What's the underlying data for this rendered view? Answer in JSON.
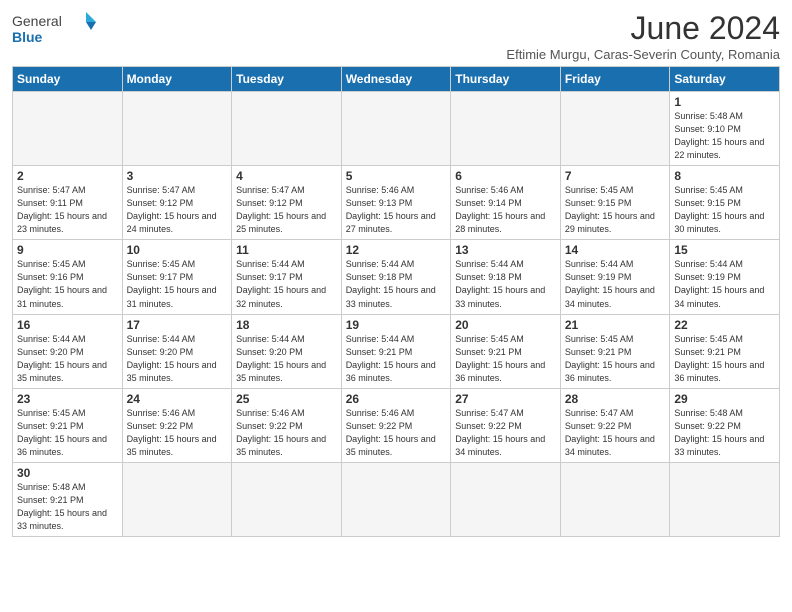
{
  "header": {
    "logo_general": "General",
    "logo_blue": "Blue",
    "month_title": "June 2024",
    "subtitle": "Eftimie Murgu, Caras-Severin County, Romania"
  },
  "weekdays": [
    "Sunday",
    "Monday",
    "Tuesday",
    "Wednesday",
    "Thursday",
    "Friday",
    "Saturday"
  ],
  "weeks": [
    [
      {
        "day": "",
        "info": ""
      },
      {
        "day": "",
        "info": ""
      },
      {
        "day": "",
        "info": ""
      },
      {
        "day": "",
        "info": ""
      },
      {
        "day": "",
        "info": ""
      },
      {
        "day": "",
        "info": ""
      },
      {
        "day": "1",
        "info": "Sunrise: 5:48 AM\nSunset: 9:10 PM\nDaylight: 15 hours\nand 22 minutes."
      }
    ],
    [
      {
        "day": "2",
        "info": "Sunrise: 5:47 AM\nSunset: 9:11 PM\nDaylight: 15 hours\nand 23 minutes."
      },
      {
        "day": "3",
        "info": "Sunrise: 5:47 AM\nSunset: 9:12 PM\nDaylight: 15 hours\nand 24 minutes."
      },
      {
        "day": "4",
        "info": "Sunrise: 5:47 AM\nSunset: 9:12 PM\nDaylight: 15 hours\nand 25 minutes."
      },
      {
        "day": "5",
        "info": "Sunrise: 5:46 AM\nSunset: 9:13 PM\nDaylight: 15 hours\nand 27 minutes."
      },
      {
        "day": "6",
        "info": "Sunrise: 5:46 AM\nSunset: 9:14 PM\nDaylight: 15 hours\nand 28 minutes."
      },
      {
        "day": "7",
        "info": "Sunrise: 5:45 AM\nSunset: 9:15 PM\nDaylight: 15 hours\nand 29 minutes."
      },
      {
        "day": "8",
        "info": "Sunrise: 5:45 AM\nSunset: 9:15 PM\nDaylight: 15 hours\nand 30 minutes."
      }
    ],
    [
      {
        "day": "9",
        "info": "Sunrise: 5:45 AM\nSunset: 9:16 PM\nDaylight: 15 hours\nand 31 minutes."
      },
      {
        "day": "10",
        "info": "Sunrise: 5:45 AM\nSunset: 9:17 PM\nDaylight: 15 hours\nand 31 minutes."
      },
      {
        "day": "11",
        "info": "Sunrise: 5:44 AM\nSunset: 9:17 PM\nDaylight: 15 hours\nand 32 minutes."
      },
      {
        "day": "12",
        "info": "Sunrise: 5:44 AM\nSunset: 9:18 PM\nDaylight: 15 hours\nand 33 minutes."
      },
      {
        "day": "13",
        "info": "Sunrise: 5:44 AM\nSunset: 9:18 PM\nDaylight: 15 hours\nand 33 minutes."
      },
      {
        "day": "14",
        "info": "Sunrise: 5:44 AM\nSunset: 9:19 PM\nDaylight: 15 hours\nand 34 minutes."
      },
      {
        "day": "15",
        "info": "Sunrise: 5:44 AM\nSunset: 9:19 PM\nDaylight: 15 hours\nand 34 minutes."
      }
    ],
    [
      {
        "day": "16",
        "info": "Sunrise: 5:44 AM\nSunset: 9:20 PM\nDaylight: 15 hours\nand 35 minutes."
      },
      {
        "day": "17",
        "info": "Sunrise: 5:44 AM\nSunset: 9:20 PM\nDaylight: 15 hours\nand 35 minutes."
      },
      {
        "day": "18",
        "info": "Sunrise: 5:44 AM\nSunset: 9:20 PM\nDaylight: 15 hours\nand 35 minutes."
      },
      {
        "day": "19",
        "info": "Sunrise: 5:44 AM\nSunset: 9:21 PM\nDaylight: 15 hours\nand 36 minutes."
      },
      {
        "day": "20",
        "info": "Sunrise: 5:45 AM\nSunset: 9:21 PM\nDaylight: 15 hours\nand 36 minutes."
      },
      {
        "day": "21",
        "info": "Sunrise: 5:45 AM\nSunset: 9:21 PM\nDaylight: 15 hours\nand 36 minutes."
      },
      {
        "day": "22",
        "info": "Sunrise: 5:45 AM\nSunset: 9:21 PM\nDaylight: 15 hours\nand 36 minutes."
      }
    ],
    [
      {
        "day": "23",
        "info": "Sunrise: 5:45 AM\nSunset: 9:21 PM\nDaylight: 15 hours\nand 36 minutes."
      },
      {
        "day": "24",
        "info": "Sunrise: 5:46 AM\nSunset: 9:22 PM\nDaylight: 15 hours\nand 35 minutes."
      },
      {
        "day": "25",
        "info": "Sunrise: 5:46 AM\nSunset: 9:22 PM\nDaylight: 15 hours\nand 35 minutes."
      },
      {
        "day": "26",
        "info": "Sunrise: 5:46 AM\nSunset: 9:22 PM\nDaylight: 15 hours\nand 35 minutes."
      },
      {
        "day": "27",
        "info": "Sunrise: 5:47 AM\nSunset: 9:22 PM\nDaylight: 15 hours\nand 34 minutes."
      },
      {
        "day": "28",
        "info": "Sunrise: 5:47 AM\nSunset: 9:22 PM\nDaylight: 15 hours\nand 34 minutes."
      },
      {
        "day": "29",
        "info": "Sunrise: 5:48 AM\nSunset: 9:22 PM\nDaylight: 15 hours\nand 33 minutes."
      }
    ],
    [
      {
        "day": "30",
        "info": "Sunrise: 5:48 AM\nSunset: 9:21 PM\nDaylight: 15 hours\nand 33 minutes."
      },
      {
        "day": "",
        "info": ""
      },
      {
        "day": "",
        "info": ""
      },
      {
        "day": "",
        "info": ""
      },
      {
        "day": "",
        "info": ""
      },
      {
        "day": "",
        "info": ""
      },
      {
        "day": "",
        "info": ""
      }
    ]
  ]
}
